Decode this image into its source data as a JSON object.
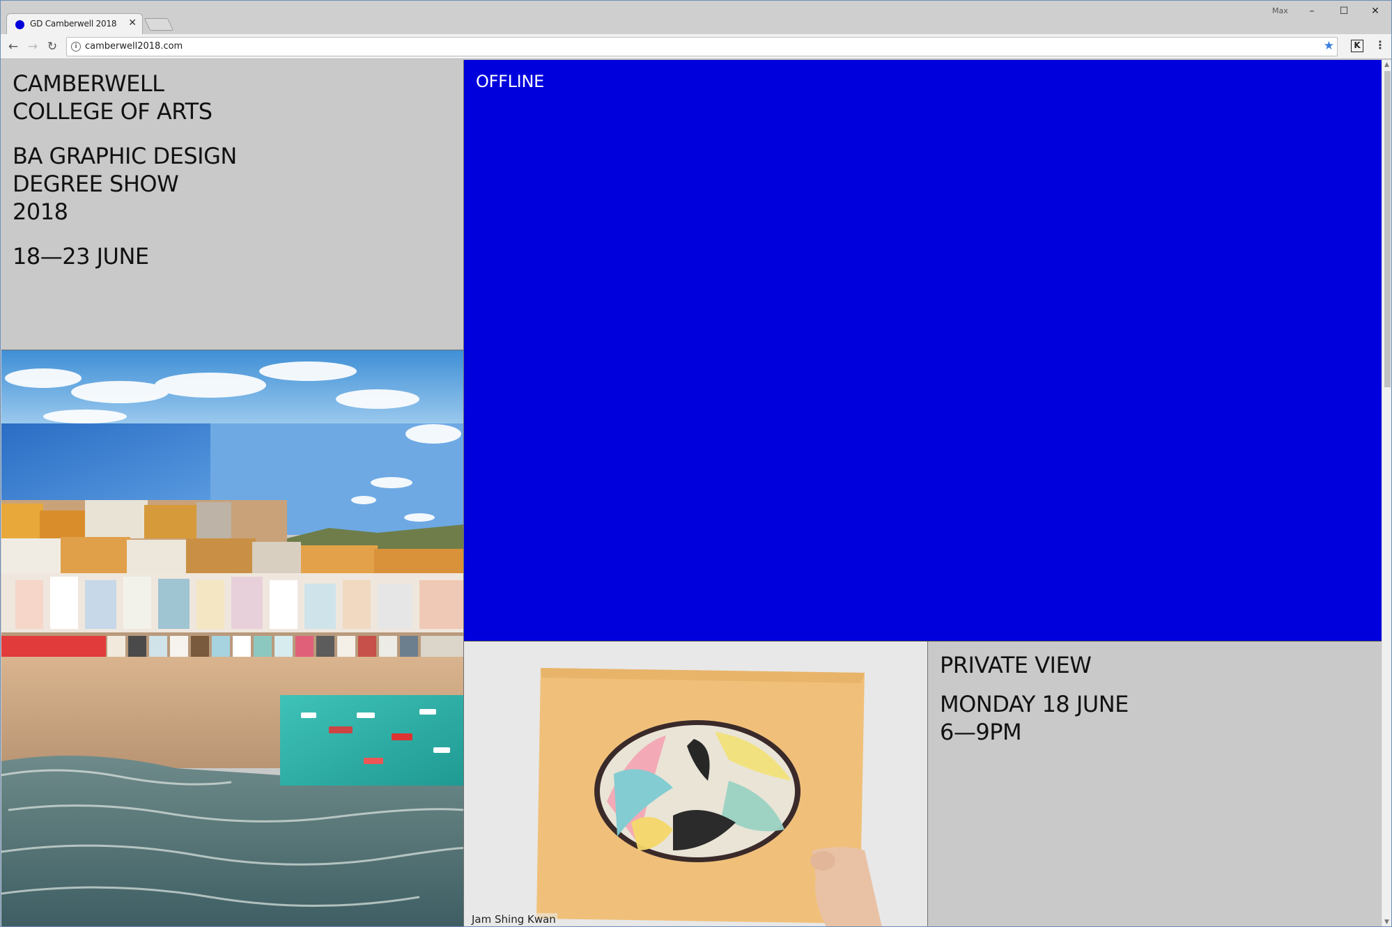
{
  "browser": {
    "tab": {
      "title": "GD Camberwell 2018",
      "close": "✕"
    },
    "user": "Max",
    "window_controls": {
      "minimize": "–",
      "maximize": "☐",
      "close": "✕"
    },
    "nav": {
      "back": "←",
      "forward": "→",
      "reload": "↻"
    },
    "url": "camberwell2018.com",
    "info_glyph": "i",
    "star": "★",
    "extension": "K",
    "menu": "⋮"
  },
  "page": {
    "title_block": {
      "institution": [
        "CAMBERWELL",
        "COLLEGE OF ARTS"
      ],
      "course": [
        "BA GRAPHIC DESIGN",
        "DEGREE SHOW",
        "2018"
      ],
      "dates": "18—23 JUNE"
    },
    "offline": {
      "label": "OFFLINE"
    },
    "featured_work": {
      "caption": "Jam Shing Kwan"
    },
    "private_view": {
      "heading": "PRIVATE VIEW",
      "date": "MONDAY 18 JUNE",
      "time": "6—9PM"
    }
  },
  "colors": {
    "offline_blue": "#0000dd",
    "panel_grey": "#c9c9c9",
    "text": "#111111"
  }
}
